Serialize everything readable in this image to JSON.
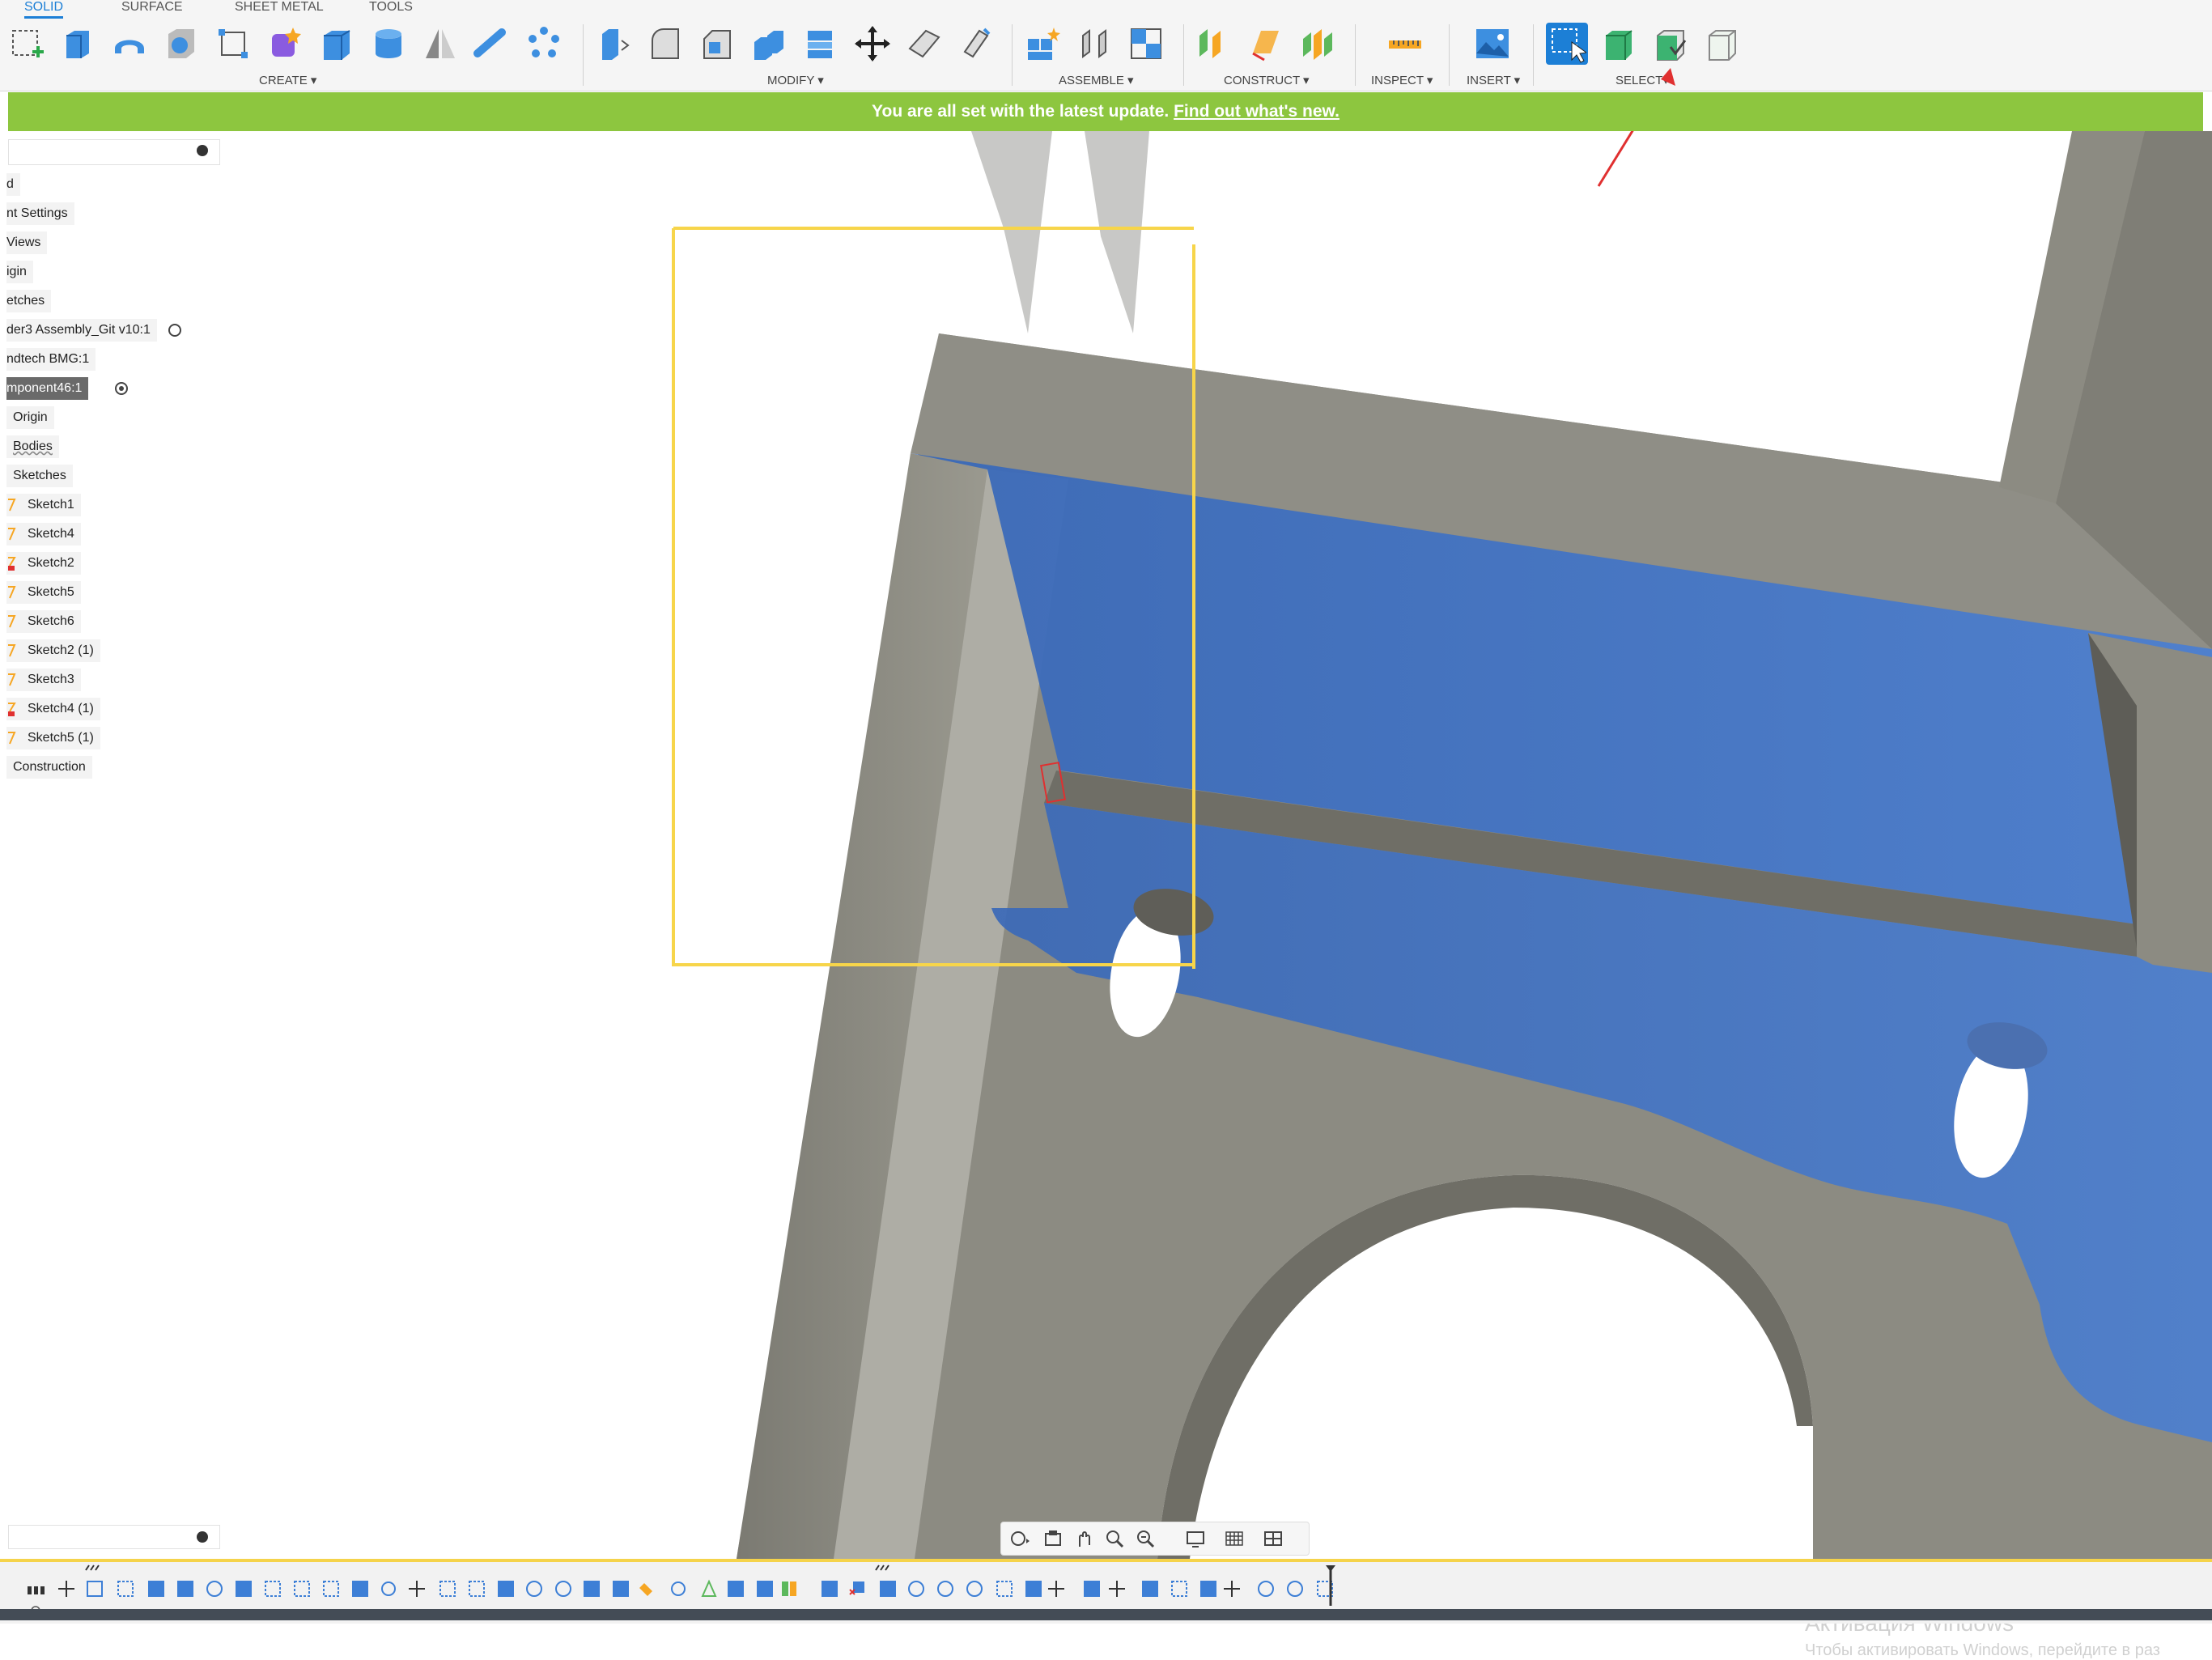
{
  "tabs": [
    "SOLID",
    "SURFACE",
    "SHEET METAL",
    "TOOLS"
  ],
  "groups": {
    "create": "CREATE ▾",
    "modify": "MODIFY ▾",
    "assemble": "ASSEMBLE ▾",
    "construct": "CONSTRUCT ▾",
    "inspect": "INSPECT ▾",
    "insert": "INSERT ▾",
    "select": "SELECT▾"
  },
  "banner": {
    "text": "You are all set with the latest update. ",
    "link": "Find out what's new."
  },
  "browser": {
    "items": [
      "d",
      "nt Settings",
      "Views",
      "igin",
      "etches",
      "der3 Assembly_Git v10:1",
      "ndtech BMG:1",
      "mponent46:1",
      "Origin",
      "Bodies",
      "Sketches",
      "Sketch1",
      "Sketch4",
      "Sketch2",
      "Sketch5",
      "Sketch6",
      "Sketch2 (1)",
      "Sketch3",
      "Sketch4 (1)",
      "Sketch5 (1)",
      "Construction"
    ]
  },
  "watermark": {
    "title": "Активация Windows",
    "subtitle": "Чтобы активировать Windows, перейдите в раз"
  },
  "colors": {
    "accent": "#1c7fd6",
    "banner": "#8dc63f",
    "face_blue": "#3c6fc0",
    "body_gray": "#8c8b82",
    "timeline_marker": "#f5d34a",
    "annotation_red": "#e03030",
    "selection_box": "#f7d54a"
  },
  "icons": {
    "select_mode": "window-select-icon",
    "arrow": "red-arrow-annotation"
  }
}
